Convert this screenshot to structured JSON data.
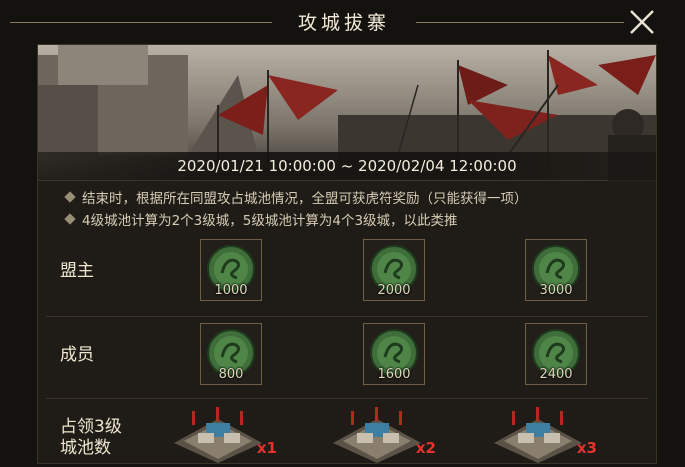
{
  "title": "攻城拔寨",
  "icons": {
    "close": "close-x-icon",
    "reward": "green-dragon-token-icon",
    "city": "city-castle-icon"
  },
  "banner": {
    "date_range": "2020/01/21 10:00:00 ~ 2020/02/04 12:00:00"
  },
  "notes": [
    "结束时，根据所在同盟攻占城池情况，全盟可获虎符奖励（只能获得一项）",
    "4级城池计算为2个3级城，5级城池计算为4个3级城，以此类推"
  ],
  "rows": {
    "leader": {
      "label": "盟主",
      "amounts": [
        "1000",
        "2000",
        "3000"
      ]
    },
    "member": {
      "label": "成员",
      "amounts": [
        "800",
        "1600",
        "2400"
      ]
    },
    "cities": {
      "label_line1": "占领3级",
      "label_line2": "城池数",
      "multipliers": [
        "x1",
        "x2",
        "x3"
      ]
    }
  },
  "colors": {
    "multiplier": "#e8312c",
    "token_green": "#3f6e3a"
  }
}
